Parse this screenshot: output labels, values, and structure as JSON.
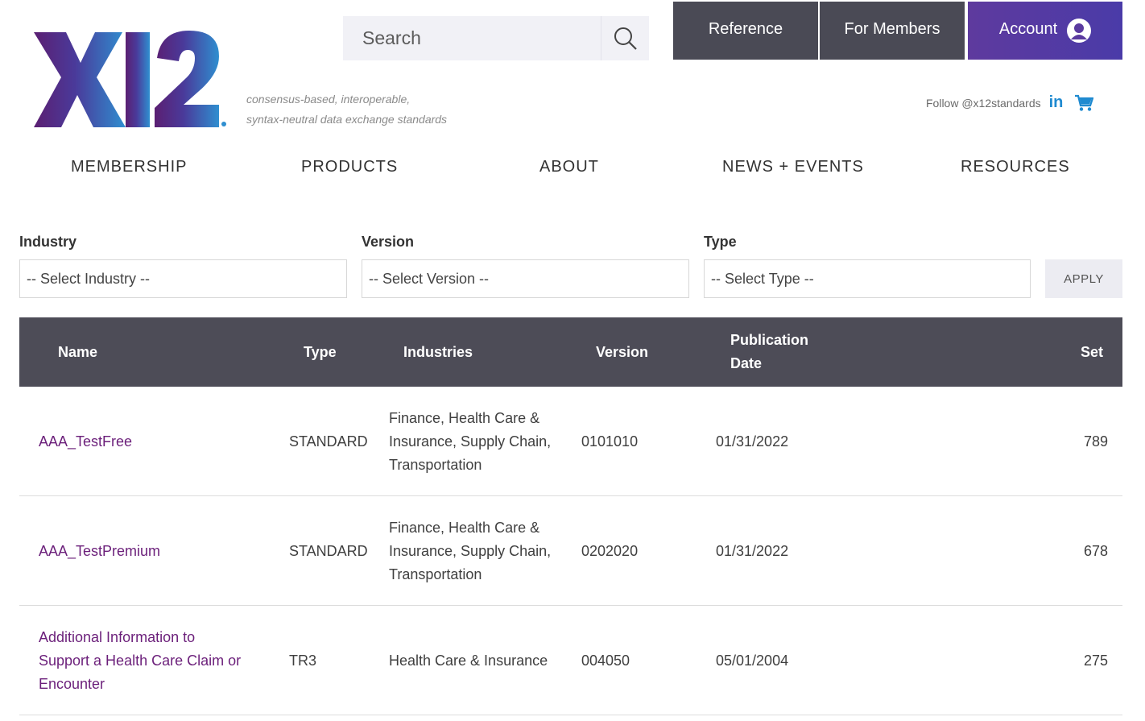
{
  "header": {
    "logo_text": "X12",
    "tagline_line1": "consensus-based, interoperable,",
    "tagline_line2": "syntax-neutral data exchange standards",
    "search_placeholder": "Search",
    "top_nav": [
      "Reference",
      "For Members",
      "Account"
    ],
    "follow_text": "Follow @x12standards",
    "linkedin_label": "in",
    "colors": {
      "dark_nav": "#4a4a55",
      "accent": "#5e3a9e",
      "link": "#6b1f7a",
      "linkedin": "#1f8ad0"
    },
    "icons": [
      "search-icon",
      "account-icon",
      "linkedin-icon",
      "cart-icon"
    ]
  },
  "main_nav": [
    "MEMBERSHIP",
    "PRODUCTS",
    "ABOUT",
    "NEWS + EVENTS",
    "RESOURCES"
  ],
  "filters": {
    "industry": {
      "label": "Industry",
      "value": "-- Select Industry --"
    },
    "version": {
      "label": "Version",
      "value": "-- Select Version --"
    },
    "type": {
      "label": "Type",
      "value": "-- Select Type --"
    },
    "apply_label": "APPLY"
  },
  "table": {
    "headers": {
      "name": "Name",
      "type": "Type",
      "industries": "Industries",
      "version": "Version",
      "pub_line1": "Publication",
      "pub_line2": "Date",
      "set": "Set"
    },
    "rows": [
      {
        "name": [
          "AAA_TestFree"
        ],
        "type": "STANDARD",
        "industries": [
          "Finance, Health Care &",
          "Insurance, Supply Chain,",
          "Transportation"
        ],
        "version": "0101010",
        "date": "01/31/2022",
        "set": "789"
      },
      {
        "name": [
          "AAA_TestPremium"
        ],
        "type": "STANDARD",
        "industries": [
          "Finance, Health Care &",
          "Insurance, Supply Chain,",
          "Transportation"
        ],
        "version": "0202020",
        "date": "01/31/2022",
        "set": "678"
      },
      {
        "name": [
          "Additional Information to",
          "Support a Health Care Claim or",
          "Encounter"
        ],
        "type": "TR3",
        "industries": [
          "Health Care & Insurance"
        ],
        "version": "004050",
        "date": "05/01/2004",
        "set": "275"
      }
    ]
  }
}
